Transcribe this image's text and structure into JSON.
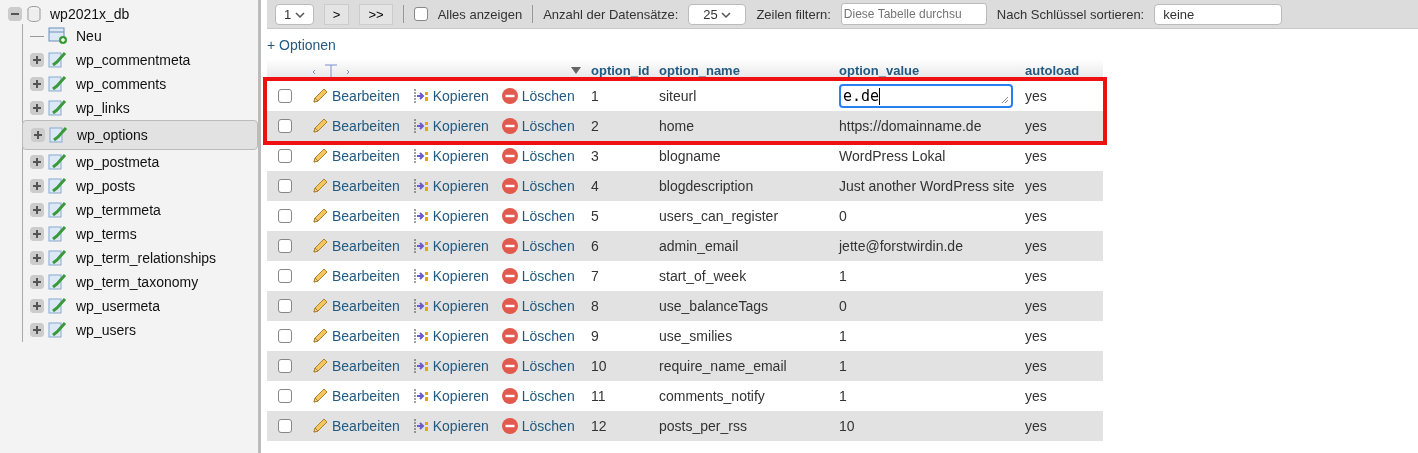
{
  "sidebar": {
    "database": {
      "label": "wp2021x_db",
      "expanded": true
    },
    "new_item": "Neu",
    "tables": [
      {
        "label": "wp_commentmeta",
        "selected": false
      },
      {
        "label": "wp_comments",
        "selected": false
      },
      {
        "label": "wp_links",
        "selected": false
      },
      {
        "label": "wp_options",
        "selected": true
      },
      {
        "label": "wp_postmeta",
        "selected": false
      },
      {
        "label": "wp_posts",
        "selected": false
      },
      {
        "label": "wp_termmeta",
        "selected": false
      },
      {
        "label": "wp_terms",
        "selected": false
      },
      {
        "label": "wp_term_relationships",
        "selected": false
      },
      {
        "label": "wp_term_taxonomy",
        "selected": false
      },
      {
        "label": "wp_usermeta",
        "selected": false
      },
      {
        "label": "wp_users",
        "selected": false
      }
    ]
  },
  "toolbar": {
    "page_select": "1",
    "next": ">",
    "last": ">>",
    "show_all": {
      "label": "Alles anzeigen",
      "checked": false
    },
    "rows_label": "Anzahl der Datensätze:",
    "rows_select": "25",
    "filter_label": "Zeilen filtern:",
    "filter_placeholder": "Diese Tabelle durchsu",
    "sort_label": "Nach Schlüssel sortieren:",
    "sort_select": "keine"
  },
  "options_link": "+ Optionen",
  "table": {
    "columns": [
      "option_id",
      "option_name",
      "option_value",
      "autoload"
    ],
    "rows": [
      {
        "checked": false,
        "highlighted": true,
        "editing": true,
        "edit": "Bearbeiten",
        "copy": "Kopieren",
        "delete": "Löschen",
        "option_id": "1",
        "option_name": "siteurl",
        "option_value": "e.de",
        "autoload": "yes"
      },
      {
        "checked": false,
        "highlighted": true,
        "editing": false,
        "edit": "Bearbeiten",
        "copy": "Kopieren",
        "delete": "Löschen",
        "option_id": "2",
        "option_name": "home",
        "option_value": "https://domainname.de",
        "autoload": "yes"
      },
      {
        "checked": false,
        "highlighted": false,
        "editing": false,
        "edit": "Bearbeiten",
        "copy": "Kopieren",
        "delete": "Löschen",
        "option_id": "3",
        "option_name": "blogname",
        "option_value": "WordPress Lokal",
        "autoload": "yes"
      },
      {
        "checked": false,
        "highlighted": false,
        "editing": false,
        "edit": "Bearbeiten",
        "copy": "Kopieren",
        "delete": "Löschen",
        "option_id": "4",
        "option_name": "blogdescription",
        "option_value": "Just another WordPress site",
        "autoload": "yes"
      },
      {
        "checked": false,
        "highlighted": false,
        "editing": false,
        "edit": "Bearbeiten",
        "copy": "Kopieren",
        "delete": "Löschen",
        "option_id": "5",
        "option_name": "users_can_register",
        "option_value": "0",
        "autoload": "yes"
      },
      {
        "checked": false,
        "highlighted": false,
        "editing": false,
        "edit": "Bearbeiten",
        "copy": "Kopieren",
        "delete": "Löschen",
        "option_id": "6",
        "option_name": "admin_email",
        "option_value": "jette@forstwirdin.de",
        "autoload": "yes"
      },
      {
        "checked": false,
        "highlighted": false,
        "editing": false,
        "edit": "Bearbeiten",
        "copy": "Kopieren",
        "delete": "Löschen",
        "option_id": "7",
        "option_name": "start_of_week",
        "option_value": "1",
        "autoload": "yes"
      },
      {
        "checked": false,
        "highlighted": false,
        "editing": false,
        "edit": "Bearbeiten",
        "copy": "Kopieren",
        "delete": "Löschen",
        "option_id": "8",
        "option_name": "use_balanceTags",
        "option_value": "0",
        "autoload": "yes"
      },
      {
        "checked": false,
        "highlighted": false,
        "editing": false,
        "edit": "Bearbeiten",
        "copy": "Kopieren",
        "delete": "Löschen",
        "option_id": "9",
        "option_name": "use_smilies",
        "option_value": "1",
        "autoload": "yes"
      },
      {
        "checked": false,
        "highlighted": false,
        "editing": false,
        "edit": "Bearbeiten",
        "copy": "Kopieren",
        "delete": "Löschen",
        "option_id": "10",
        "option_name": "require_name_email",
        "option_value": "1",
        "autoload": "yes"
      },
      {
        "checked": false,
        "highlighted": false,
        "editing": false,
        "edit": "Bearbeiten",
        "copy": "Kopieren",
        "delete": "Löschen",
        "option_id": "11",
        "option_name": "comments_notify",
        "option_value": "1",
        "autoload": "yes"
      },
      {
        "checked": false,
        "highlighted": false,
        "editing": false,
        "edit": "Bearbeiten",
        "copy": "Kopieren",
        "delete": "Löschen",
        "option_id": "12",
        "option_name": "posts_per_rss",
        "option_value": "10",
        "autoload": "yes"
      }
    ]
  }
}
